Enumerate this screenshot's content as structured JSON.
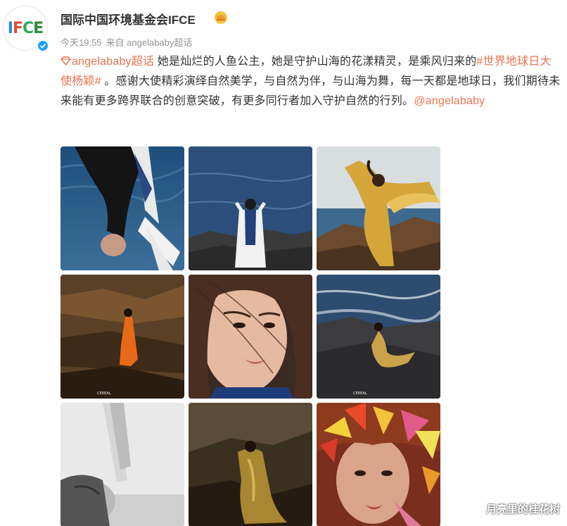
{
  "user": {
    "name": "国际中国环境基金会IFCE",
    "avatar_text": "IFCE",
    "avatar_colors": [
      "#1e8fd6",
      "#e24a3b",
      "#2eab57",
      "#2f8a3e"
    ],
    "vip_icon": "crown-icon",
    "verified_icon": "verified-check-icon"
  },
  "meta": {
    "time": "今天19:55",
    "source": "来自 angelababy超话"
  },
  "post": {
    "topic": "angelababy超话",
    "text1": " 她是灿烂的人鱼公主，她是守护山海的花漾精灵，是乘风归来的",
    "hashtag": "#世界地球日大使杨颖#",
    "text2": " 。感谢大使精彩演绎自然美学，与自然为伴，与山海为舞，每一天都是地球日，我们期待未来能有更多跨界联合的创意突破，有更多同行者加入守护自然的行列。",
    "mention": "@angelababy"
  },
  "photos": {
    "watermark_text": "CEREAL",
    "earth_day_text": "国际中国环境基金会IFCE",
    "items": [
      "photo-1",
      "photo-2",
      "photo-3",
      "photo-4",
      "photo-5",
      "photo-6",
      "photo-7",
      "photo-8",
      "photo-9"
    ]
  },
  "colors": {
    "link": "#eb7350",
    "meta": "#939393",
    "verified": "#1e9fff"
  },
  "watermark": "月亮里的桂花树"
}
